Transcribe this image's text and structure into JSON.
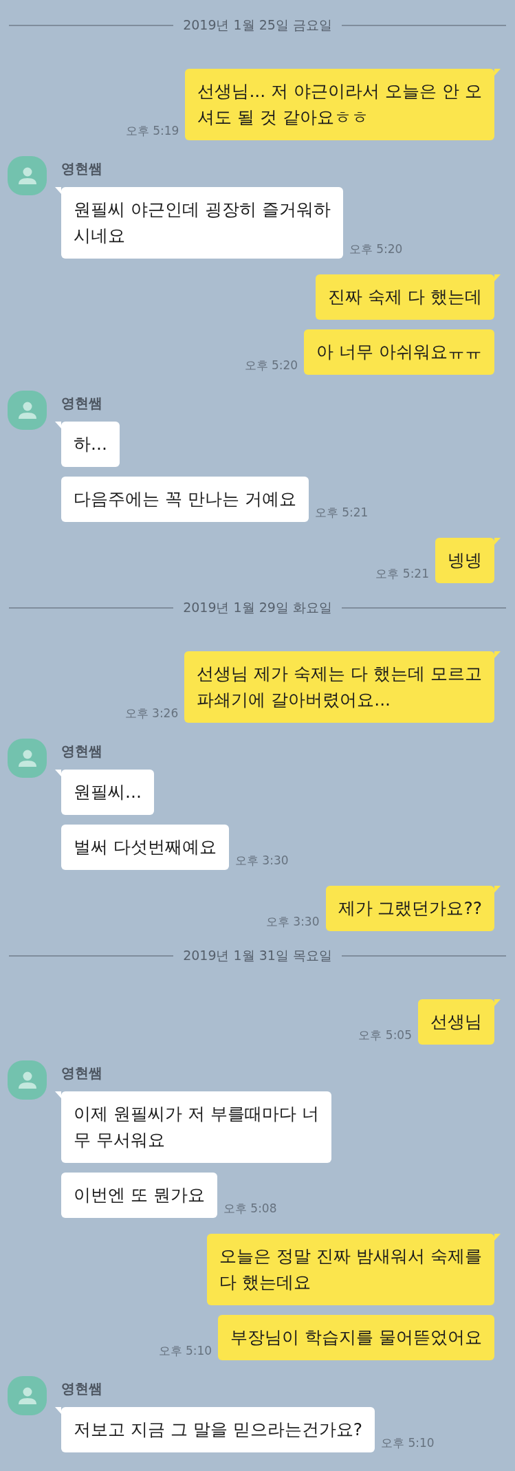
{
  "chat": [
    {
      "kind": "date",
      "label": "2019년 1월 25일 금요일"
    },
    {
      "kind": "sent",
      "messages": [
        {
          "text": "선생님... 저 야근이라서 오늘은 안 오\n셔도 될 것 같아요ㅎㅎ",
          "time": "오후 5:19"
        }
      ]
    },
    {
      "kind": "received",
      "sender": "영현쌤",
      "messages": [
        {
          "text": "원필씨 야근인데 굉장히 즐거워하\n시네요",
          "time": "오후 5:20"
        }
      ]
    },
    {
      "kind": "sent",
      "messages": [
        {
          "text": "진짜 숙제 다 했는데"
        },
        {
          "text": "아 너무 아쉬워요ㅠㅠ",
          "time": "오후 5:20"
        }
      ]
    },
    {
      "kind": "received",
      "sender": "영현쌤",
      "messages": [
        {
          "text": "하..."
        },
        {
          "text": "다음주에는 꼭 만나는 거예요",
          "time": "오후 5:21"
        }
      ]
    },
    {
      "kind": "sent",
      "messages": [
        {
          "text": "넹넹",
          "time": "오후 5:21"
        }
      ]
    },
    {
      "kind": "date",
      "label": "2019년 1월 29일 화요일"
    },
    {
      "kind": "sent",
      "messages": [
        {
          "text": "선생님 제가 숙제는 다 했는데 모르고\n파쇄기에 갈아버렸어요...",
          "time": "오후 3:26"
        }
      ]
    },
    {
      "kind": "received",
      "sender": "영현쌤",
      "messages": [
        {
          "text": "원필씨..."
        },
        {
          "text": "벌써 다섯번째예요",
          "time": "오후 3:30"
        }
      ]
    },
    {
      "kind": "sent",
      "messages": [
        {
          "text": "제가 그랬던가요??",
          "time": "오후 3:30"
        }
      ]
    },
    {
      "kind": "date",
      "label": "2019년 1월 31일 목요일"
    },
    {
      "kind": "sent",
      "messages": [
        {
          "text": "선생님",
          "time": "오후 5:05"
        }
      ]
    },
    {
      "kind": "received",
      "sender": "영현쌤",
      "messages": [
        {
          "text": "이제 원필씨가 저 부를때마다 너\n무 무서워요"
        },
        {
          "text": "이번엔 또 뭔가요",
          "time": "오후 5:08"
        }
      ]
    },
    {
      "kind": "sent",
      "messages": [
        {
          "text": "오늘은 정말 진짜 밤새워서 숙제를\n다 했는데요"
        },
        {
          "text": "부장님이 학습지를 물어뜯었어요",
          "time": "오후 5:10"
        }
      ]
    },
    {
      "kind": "received",
      "sender": "영현쌤",
      "messages": [
        {
          "text": "저보고 지금 그 말을 믿으라는건가요?",
          "time": "오후 5:10"
        }
      ]
    }
  ]
}
